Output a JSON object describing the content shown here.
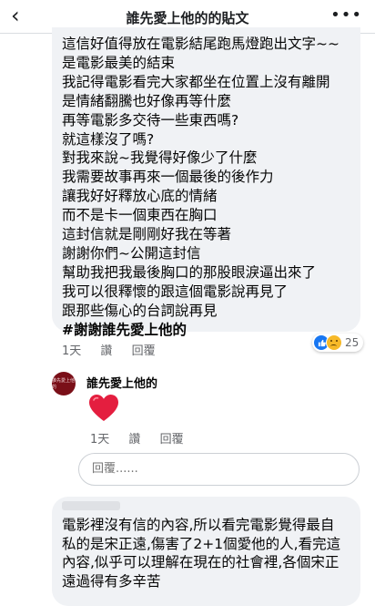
{
  "nav": {
    "back": "‹",
    "title": "誰先愛上他的的貼文",
    "more": "•••"
  },
  "comment1": {
    "lines": [
      "這信好值得放在電影結尾跑馬燈跑出文字~~",
      "是電影最美的結束",
      "我記得電影看完大家都坐在位置上沒有離開",
      "是情緒翻騰也好像再等什麼",
      "再等電影多交待一些東西嗎?",
      "就這樣沒了嗎?",
      "對我來說~我覺得好像少了什麼",
      "我需要故事再來一個最後的後作力",
      "讓我好好釋放心底的情緒",
      "而不是卡一個東西在胸口",
      "這封信就是剛剛好我在等著",
      "謝謝你們~公開這封信",
      "幫助我把我最後胸口的那股眼淚逼出來了",
      "我可以很釋懷的跟這個電影說再見了",
      "跟那些傷心的台詞說再見"
    ],
    "hashtag": "#謝謝誰先愛上他的",
    "time": "1天",
    "like": "讚",
    "reply": "回覆",
    "reaction_count": "25"
  },
  "reply1": {
    "author": "誰先愛上他的",
    "avatar_text": "誰先愛上他的",
    "time": "1天",
    "like": "讚",
    "reply": "回覆"
  },
  "reply_input": {
    "placeholder": "回覆......"
  },
  "comment2": {
    "lines": [
      "電影裡沒有信的內容,所以看完電影覺得最自",
      "私的是宋正遠,傷害了2+1個愛他的人,看完這",
      "內容,似乎可以理解在現在的社會裡,各個宋正",
      "遠過得有多辛苦"
    ]
  },
  "colors": {
    "bubble": "#f0f2f5",
    "like_blue": "#1877f2",
    "heart_red": "#e41e3f",
    "meta_gray": "#65676b"
  }
}
